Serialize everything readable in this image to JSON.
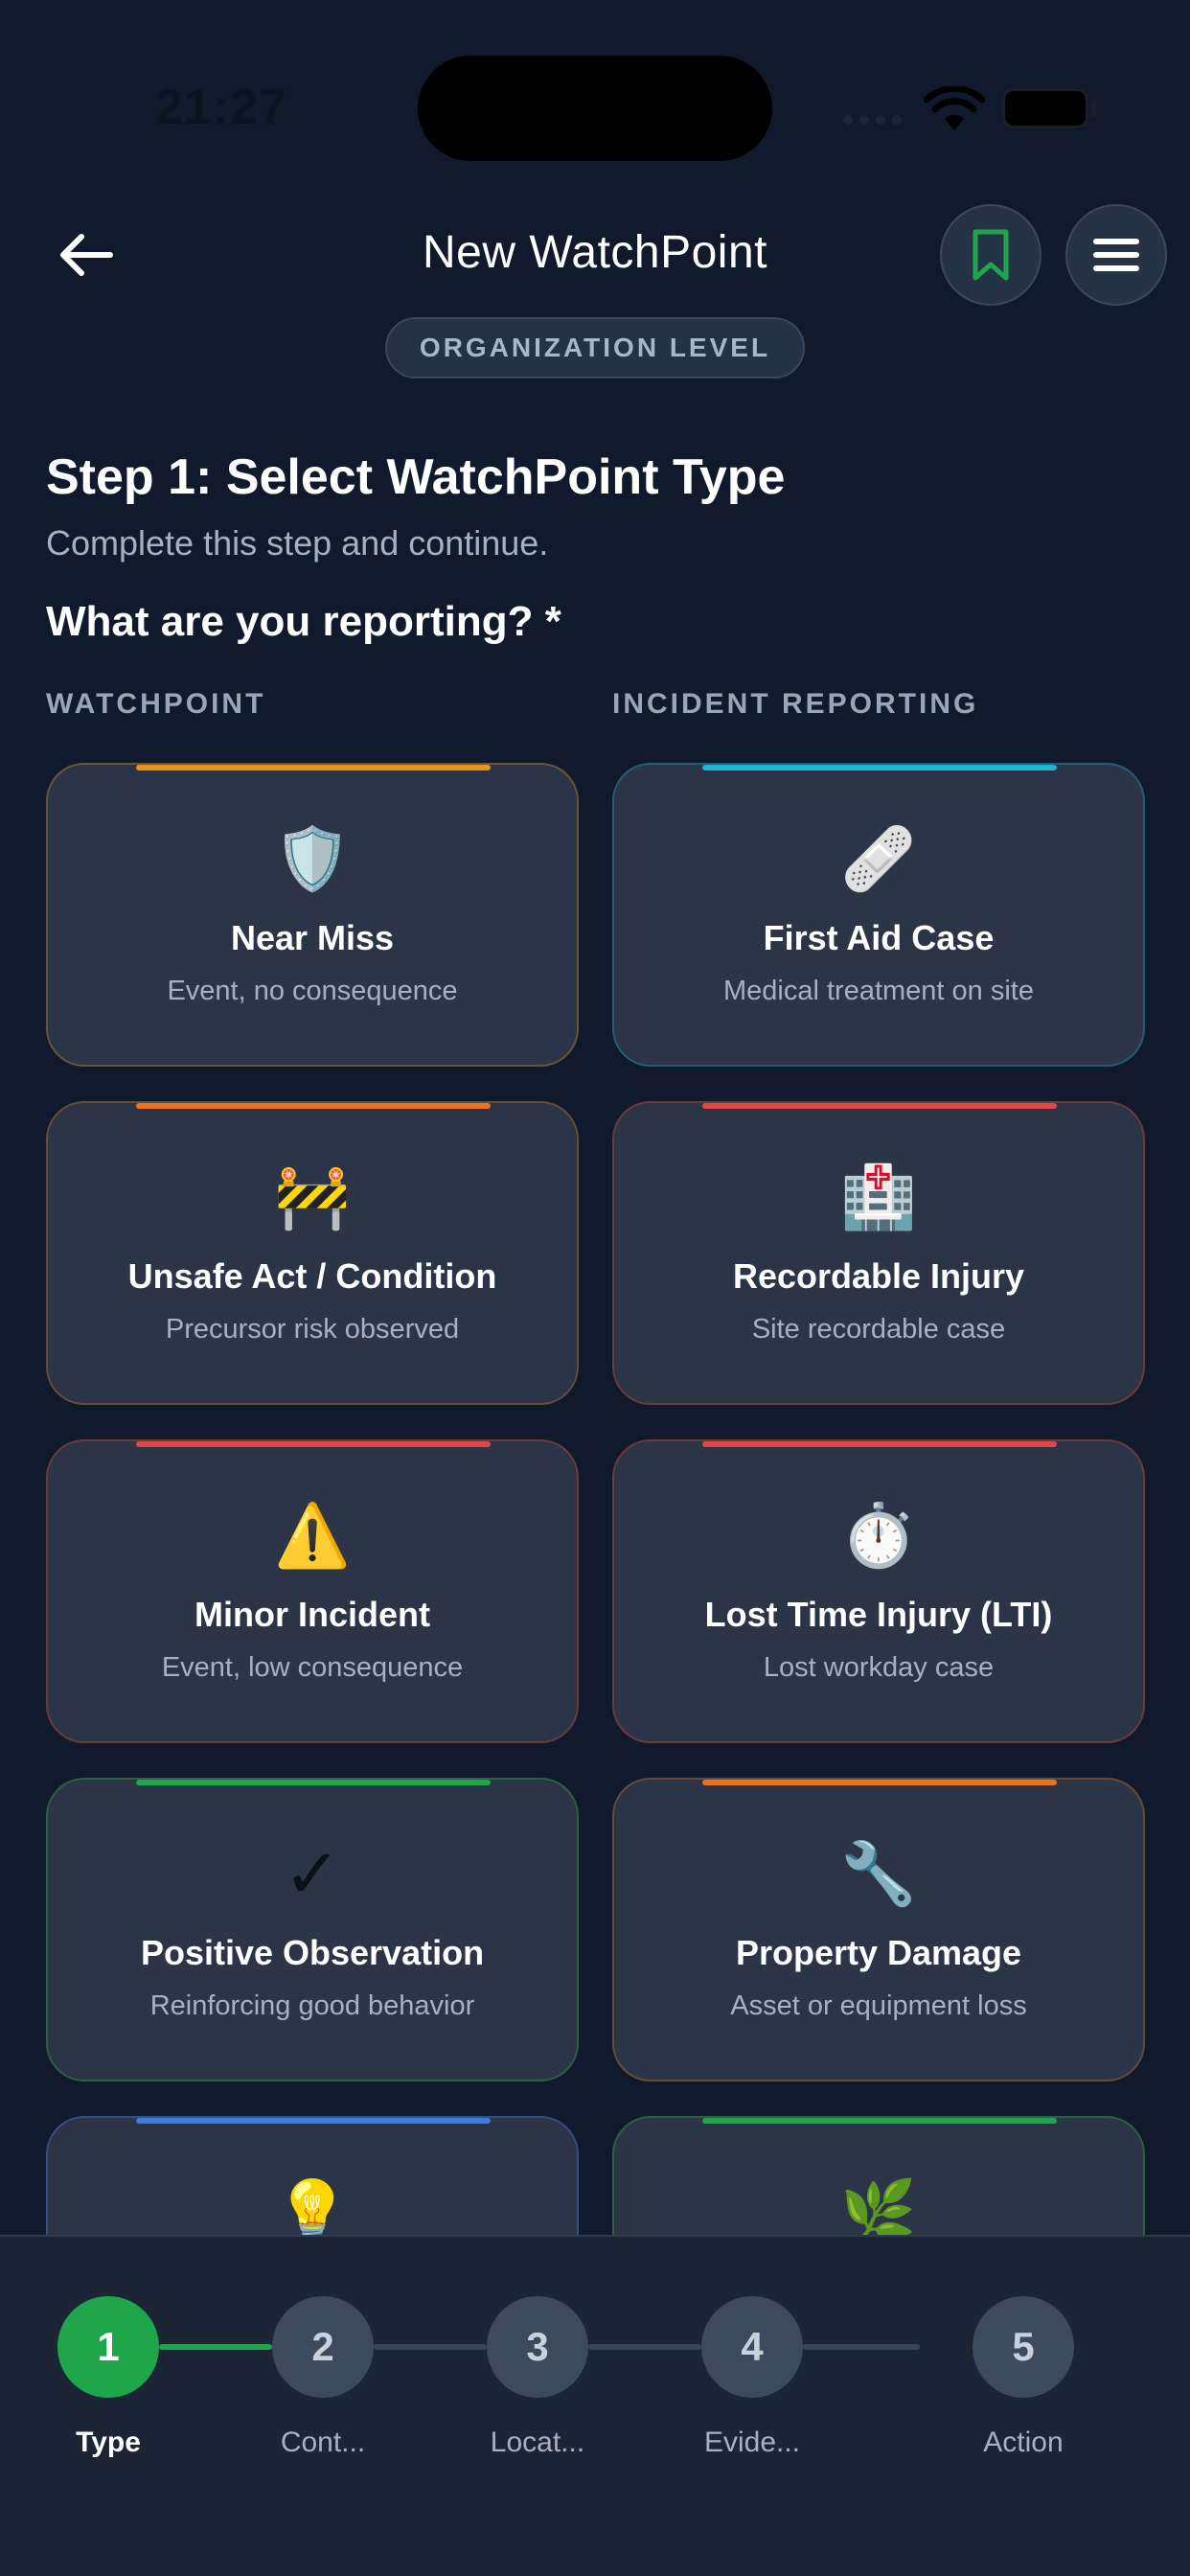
{
  "status_bar": {
    "time": "21:27"
  },
  "header": {
    "title": "New WatchPoint",
    "level_badge": "ORGANIZATION LEVEL",
    "icons": {
      "back": "arrow-left-icon",
      "bookmark": "bookmark-icon",
      "menu": "hamburger-menu-icon"
    },
    "bookmark_color": "#1fa64a"
  },
  "step": {
    "title": "Step 1: Select WatchPoint Type",
    "subtitle": "Complete this step and continue.",
    "question": "What are you reporting? *"
  },
  "columns": {
    "left": "WATCHPOINT",
    "right": "INCIDENT REPORTING"
  },
  "cards": [
    {
      "id": "near-miss",
      "icon": "🛡️",
      "icon_name": "shield-icon",
      "name": "Near Miss",
      "desc": "Event, no consequence",
      "accent": "#e8951a",
      "border": "#6b5532"
    },
    {
      "id": "first-aid-case",
      "icon": "🩹",
      "icon_name": "bandage-icon",
      "name": "First Aid Case",
      "desc": "Medical treatment on site",
      "accent": "#1fb3d6",
      "border": "#1f5f78"
    },
    {
      "id": "unsafe-act",
      "icon": "🚧",
      "icon_name": "construction-barrier-icon",
      "name": "Unsafe Act / Condition",
      "desc": "Precursor risk observed",
      "accent": "#e8731f",
      "border": "#6b4a32"
    },
    {
      "id": "recordable-injury",
      "icon": "🏥",
      "icon_name": "hospital-icon",
      "name": "Recordable Injury",
      "desc": "Site recordable case",
      "accent": "#e04848",
      "border": "#6e3840"
    },
    {
      "id": "minor-incident",
      "icon": "⚠️",
      "icon_name": "warning-icon",
      "name": "Minor Incident",
      "desc": "Event, low consequence",
      "accent": "#e04848",
      "border": "#6e3840"
    },
    {
      "id": "lost-time-injury",
      "icon": "⏱️",
      "icon_name": "stopwatch-icon",
      "name": "Lost Time Injury (LTI)",
      "desc": "Lost workday case",
      "accent": "#e04848",
      "border": "#6e3840"
    },
    {
      "id": "positive-observation",
      "icon": "✓",
      "icon_name": "checkmark-icon",
      "name": "Positive Observation",
      "desc": "Reinforcing good behavior",
      "accent": "#1fa64a",
      "border": "#2e5e46"
    },
    {
      "id": "property-damage",
      "icon": "🔧",
      "icon_name": "wrench-icon",
      "name": "Property Damage",
      "desc": "Asset or equipment loss",
      "accent": "#e8731f",
      "border": "#6b4a32"
    },
    {
      "id": "suggestion",
      "icon": "💡",
      "icon_name": "lightbulb-icon",
      "name": "",
      "desc": "",
      "accent": "#3b7de0",
      "border": "#34507e"
    },
    {
      "id": "environmental",
      "icon": "🌿",
      "icon_name": "leaf-icon",
      "name": "",
      "desc": "",
      "accent": "#1fa64a",
      "border": "#2e5e46"
    }
  ],
  "stepper": {
    "active_color": "#1fa64a",
    "steps": [
      {
        "number": "1",
        "label": "Type",
        "active": true
      },
      {
        "number": "2",
        "label": "Cont...",
        "active": false
      },
      {
        "number": "3",
        "label": "Locat...",
        "active": false
      },
      {
        "number": "4",
        "label": "Evide...",
        "active": false
      },
      {
        "number": "5",
        "label": "Action",
        "active": false
      }
    ]
  }
}
